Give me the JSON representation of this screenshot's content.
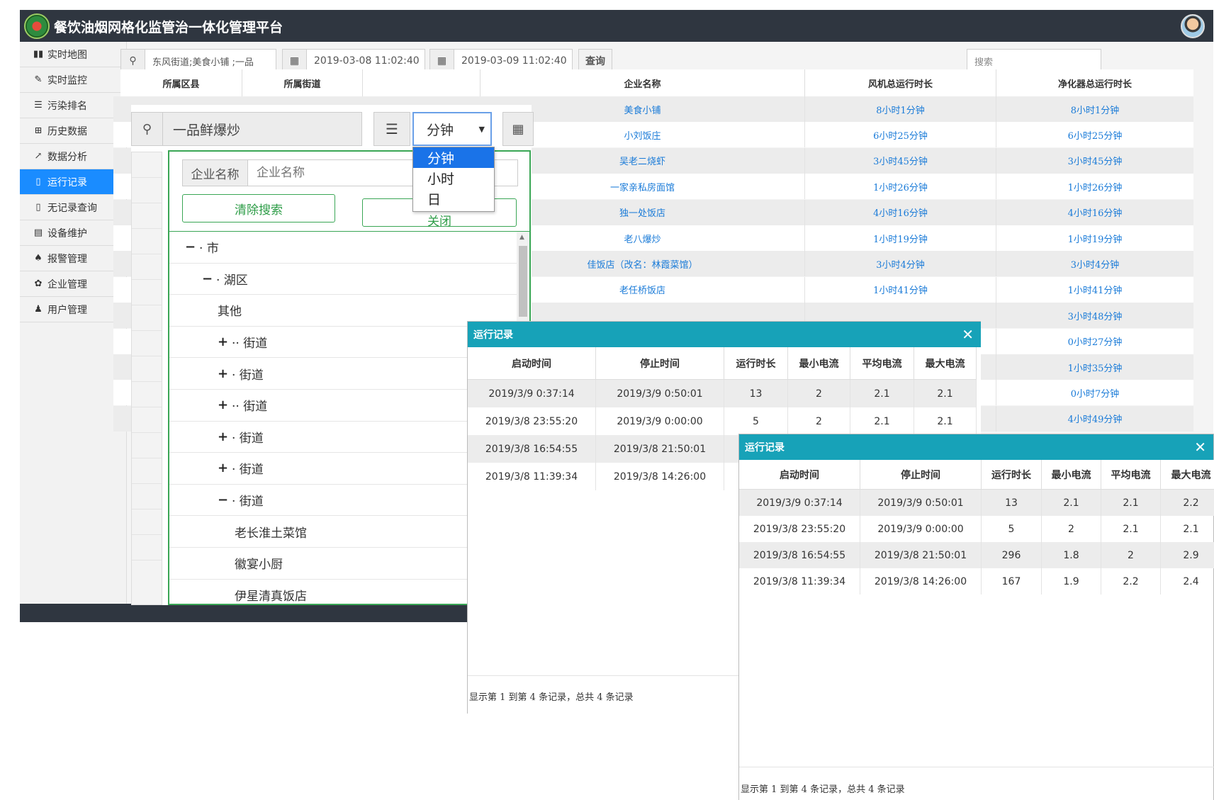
{
  "app": {
    "title": "餐饮油烟网格化监管治一体化管理平台"
  },
  "sidebar": {
    "items": [
      {
        "icon": "map-icon",
        "glyph": "▮▮",
        "label": "实时地图",
        "active": false
      },
      {
        "icon": "monitor-icon",
        "glyph": "✎",
        "label": "实时监控",
        "active": false
      },
      {
        "icon": "list-icon",
        "glyph": "☰",
        "label": "污染排名",
        "active": false
      },
      {
        "icon": "table-icon",
        "glyph": "⊞",
        "label": "历史数据",
        "active": false
      },
      {
        "icon": "chart-icon",
        "glyph": "↗",
        "label": "数据分析",
        "active": false
      },
      {
        "icon": "file-icon",
        "glyph": "▯",
        "label": "运行记录",
        "active": true
      },
      {
        "icon": "file-icon",
        "glyph": "▯",
        "label": "无记录查询",
        "active": false
      },
      {
        "icon": "doc-icon",
        "glyph": "▤",
        "label": "设备维护",
        "active": false
      },
      {
        "icon": "bell-icon",
        "glyph": "♠",
        "label": "报警管理",
        "active": false
      },
      {
        "icon": "gear-icon",
        "glyph": "✿",
        "label": "企业管理",
        "active": false
      },
      {
        "icon": "user-icon",
        "glyph": "♟",
        "label": "用户管理",
        "active": false
      }
    ]
  },
  "toolbar": {
    "location": "东风街道;美食小铺     ;一品",
    "start_time": "2019-03-08 11:02:40",
    "end_time": "2019-03-09 11:02:40",
    "query_label": "查询",
    "search_placeholder": "搜索"
  },
  "main_table": {
    "left_headers": [
      "所属区县",
      "所属街道"
    ],
    "headers": [
      "企业名称",
      "风机总运行时长",
      "净化器总运行时长"
    ],
    "rows": [
      [
        "美食小铺",
        "8小时1分钟",
        "8小时1分钟"
      ],
      [
        "小刘饭庄",
        "6小时25分钟",
        "6小时25分钟"
      ],
      [
        "吴老二烧虾",
        "3小时45分钟",
        "3小时45分钟"
      ],
      [
        "一家亲私房面馆",
        "1小时26分钟",
        "1小时26分钟"
      ],
      [
        "独一处饭店",
        "4小时16分钟",
        "4小时16分钟"
      ],
      [
        "老八爆炒",
        "1小时19分钟",
        "1小时19分钟"
      ],
      [
        "佳饭店（改名：林霞菜馆）",
        "3小时4分钟",
        "3小时4分钟"
      ],
      [
        "老任桥饭店",
        "1小时41分钟",
        "1小时41分钟"
      ],
      [
        "",
        "",
        "3小时48分钟"
      ],
      [
        "",
        "",
        "0小时27分钟"
      ],
      [
        "",
        "",
        "1小时35分钟"
      ],
      [
        "",
        "",
        "0小时7分钟"
      ],
      [
        "",
        "",
        "4小时49分钟"
      ]
    ]
  },
  "selector": {
    "location": "一品鲜爆炒",
    "unit": "分钟",
    "unit_options": [
      "分钟",
      "小时",
      "日"
    ],
    "search_label": "企业名称",
    "search_placeholder": "企业名称",
    "clear_label": "清除搜索",
    "close_label": "关闭",
    "tree": [
      {
        "toggle": "−",
        "label": "·   市",
        "level": 0
      },
      {
        "toggle": "−",
        "label": "·  湖区",
        "level": 1
      },
      {
        "toggle": "",
        "label": "其他",
        "level": 2
      },
      {
        "toggle": "+",
        "label": "··  街道",
        "level": 2
      },
      {
        "toggle": "+",
        "label": "·  街道",
        "level": 2
      },
      {
        "toggle": "+",
        "label": "··  街道",
        "level": 2
      },
      {
        "toggle": "+",
        "label": "·  街道",
        "level": 2
      },
      {
        "toggle": "+",
        "label": "·  街道",
        "level": 2
      },
      {
        "toggle": "−",
        "label": "·  街道",
        "level": 2
      },
      {
        "toggle": "",
        "label": "老长淮土菜馆",
        "level": 3
      },
      {
        "toggle": "",
        "label": "徽宴小厨",
        "level": 3
      },
      {
        "toggle": "",
        "label": "伊星清真饭店",
        "level": 3
      }
    ]
  },
  "dialog1": {
    "title": "运行记录",
    "headers": [
      "启动时间",
      "停止时间",
      "运行时长",
      "最小电流",
      "平均电流",
      "最大电流"
    ],
    "rows": [
      [
        "2019/3/9 0:37:14",
        "2019/3/9 0:50:01",
        "13",
        "2",
        "2.1",
        "2.1"
      ],
      [
        "2019/3/8 23:55:20",
        "2019/3/9 0:00:00",
        "5",
        "2",
        "2.1",
        "2.1"
      ],
      [
        "2019/3/8 16:54:55",
        "2019/3/8 21:50:01",
        "",
        "",
        "",
        ""
      ],
      [
        "2019/3/8 11:39:34",
        "2019/3/8 14:26:00",
        "",
        "",
        "",
        ""
      ]
    ],
    "footer": "显示第 1 到第 4 条记录，总共 4 条记录"
  },
  "dialog2": {
    "title": "运行记录",
    "headers": [
      "启动时间",
      "停止时间",
      "运行时长",
      "最小电流",
      "平均电流",
      "最大电流"
    ],
    "rows": [
      [
        "2019/3/9 0:37:14",
        "2019/3/9 0:50:01",
        "13",
        "2.1",
        "2.1",
        "2.2"
      ],
      [
        "2019/3/8 23:55:20",
        "2019/3/9 0:00:00",
        "5",
        "2",
        "2.1",
        "2.1"
      ],
      [
        "2019/3/8 16:54:55",
        "2019/3/8 21:50:01",
        "296",
        "1.8",
        "2",
        "2.9"
      ],
      [
        "2019/3/8 11:39:34",
        "2019/3/8 14:26:00",
        "167",
        "1.9",
        "2.2",
        "2.4"
      ]
    ],
    "footer": "显示第 1 到第 4 条记录，总共 4 条记录"
  },
  "colors": {
    "topbar": "#2f3640",
    "active": "#1a8cff",
    "dialog_header": "#17a2b8",
    "tree_border": "#3aa655",
    "link": "#1a7bd8"
  }
}
